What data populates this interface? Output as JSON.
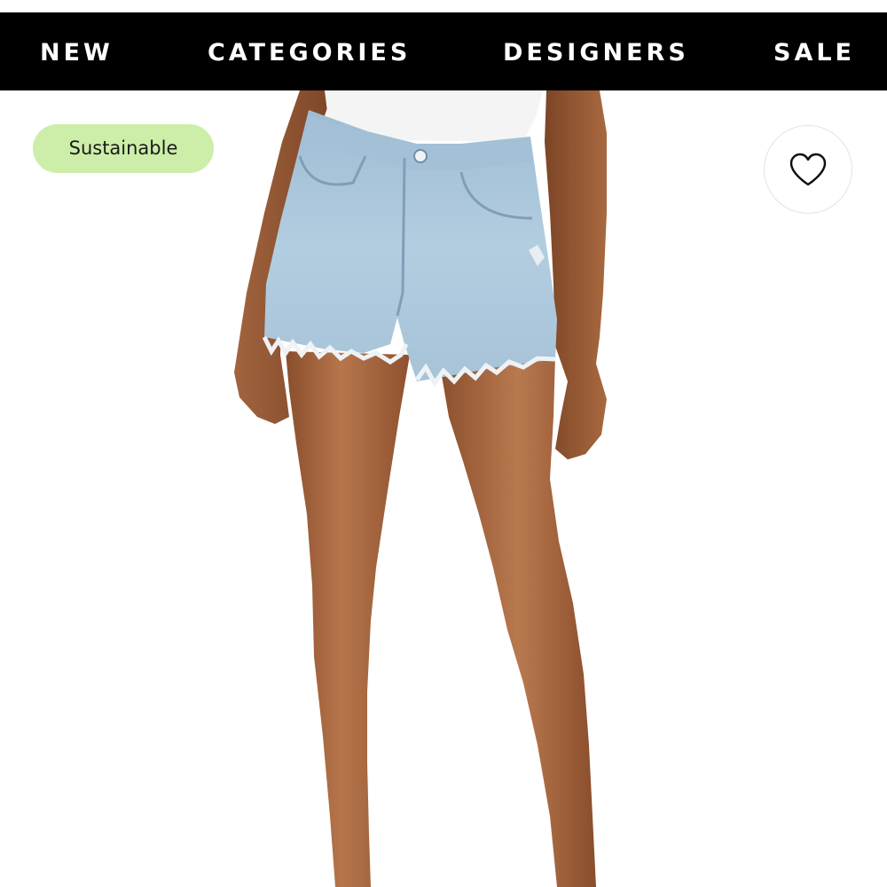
{
  "nav": {
    "items": [
      {
        "label": "NEW"
      },
      {
        "label": "CATEGORIES"
      },
      {
        "label": "DESIGNERS"
      },
      {
        "label": "SALE"
      }
    ]
  },
  "product": {
    "badge": "Sustainable",
    "wishlist_icon": "heart-outline-icon"
  },
  "colors": {
    "nav_background": "#000000",
    "nav_text": "#ffffff",
    "badge_background": "#cdeea8",
    "skin": "#a4643f",
    "denim": "#aac8dc",
    "shirt": "#f4f4f4"
  }
}
